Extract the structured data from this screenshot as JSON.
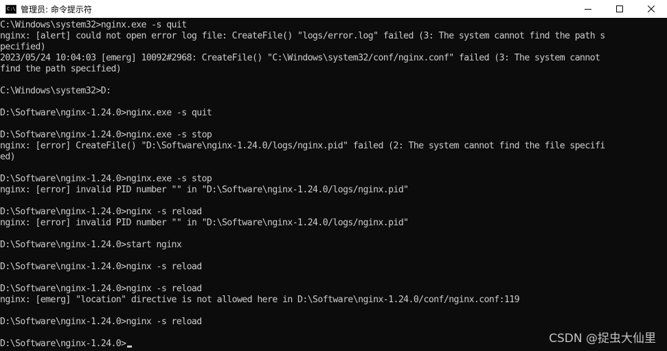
{
  "window": {
    "title": "管理员: 命令提示符",
    "icon": "console-icon",
    "icon_text": "C:\\"
  },
  "controls": {
    "minimize": "minimize-icon",
    "maximize": "maximize-icon",
    "close": "close-icon"
  },
  "console": {
    "lines": [
      "C:\\Windows\\system32>nginx.exe -s quit",
      "nginx: [alert] could not open error log file: CreateFile() \"logs/error.log\" failed (3: The system cannot find the path s",
      "pecified)",
      "2023/05/24 10:04:03 [emerg] 10092#2968: CreateFile() \"C:\\Windows\\system32/conf/nginx.conf\" failed (3: The system cannot",
      "find the path specified)",
      "",
      "C:\\Windows\\system32>D:",
      "",
      "D:\\Software\\nginx-1.24.0>nginx.exe -s quit",
      "",
      "D:\\Software\\nginx-1.24.0>nginx.exe -s stop",
      "nginx: [error] CreateFile() \"D:\\Software\\nginx-1.24.0/logs/nginx.pid\" failed (2: The system cannot find the file specifi",
      "ed)",
      "",
      "D:\\Software\\nginx-1.24.0>nginx.exe -s stop",
      "nginx: [error] invalid PID number \"\" in \"D:\\Software\\nginx-1.24.0/logs/nginx.pid\"",
      "",
      "D:\\Software\\nginx-1.24.0>nginx -s reload",
      "nginx: [error] invalid PID number \"\" in \"D:\\Software\\nginx-1.24.0/logs/nginx.pid\"",
      "",
      "D:\\Software\\nginx-1.24.0>start nginx",
      "",
      "D:\\Software\\nginx-1.24.0>nginx -s reload",
      "",
      "D:\\Software\\nginx-1.24.0>nginx -s reload",
      "nginx: [emerg] \"location\" directive is not allowed here in D:\\Software\\nginx-1.24.0/conf/nginx.conf:119",
      "",
      "D:\\Software\\nginx-1.24.0>nginx -s reload",
      "",
      "D:\\Software\\nginx-1.24.0>"
    ]
  },
  "watermark": {
    "text": "CSDN @捉虫大仙里"
  },
  "colors": {
    "console_bg": "#0c0c0c",
    "console_fg": "#cccccc",
    "titlebar_bg": "#ffffff"
  }
}
